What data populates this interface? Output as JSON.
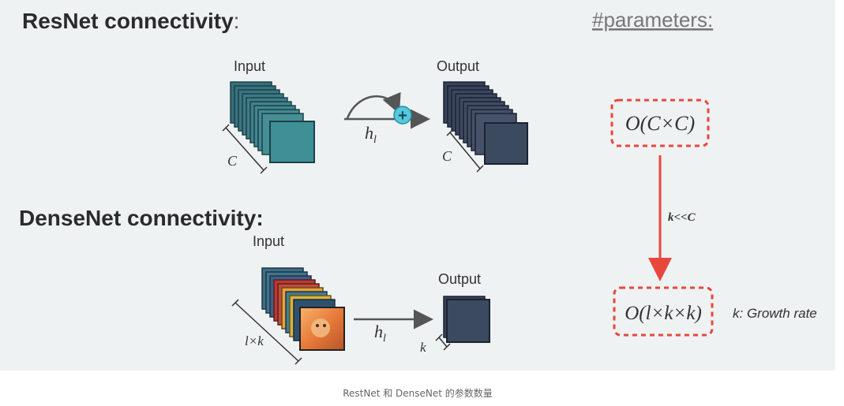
{
  "resnet": {
    "title": "ResNet connectivity",
    "title_colon": ":",
    "input_label": "Input",
    "output_label": "Output",
    "function_label": "h",
    "function_sub": "l",
    "channel_label_in": "C",
    "channel_label_out": "C",
    "add_symbol": "+"
  },
  "densenet": {
    "title": "DenseNet connectivity:",
    "input_label": "Input",
    "output_label": "Output",
    "function_label": "h",
    "function_sub": "l",
    "channel_label_in": "l×k",
    "channel_label_out": "k"
  },
  "parameters": {
    "heading": "#parameters:",
    "resnet_complexity": "O(C×C)",
    "arrow_label": "k<<C",
    "densenet_complexity": "O(l×k×k)",
    "growth_note": "k: Growth rate"
  },
  "caption": "RestNet 和 DenseNet 的参数数量",
  "colors": {
    "slide_bg": "#eef2f3",
    "resnet_block": "#3e7f8c",
    "output_block": "#3c4a60",
    "accent_red": "#e8473c",
    "plus_circle": "#56c8e0"
  }
}
